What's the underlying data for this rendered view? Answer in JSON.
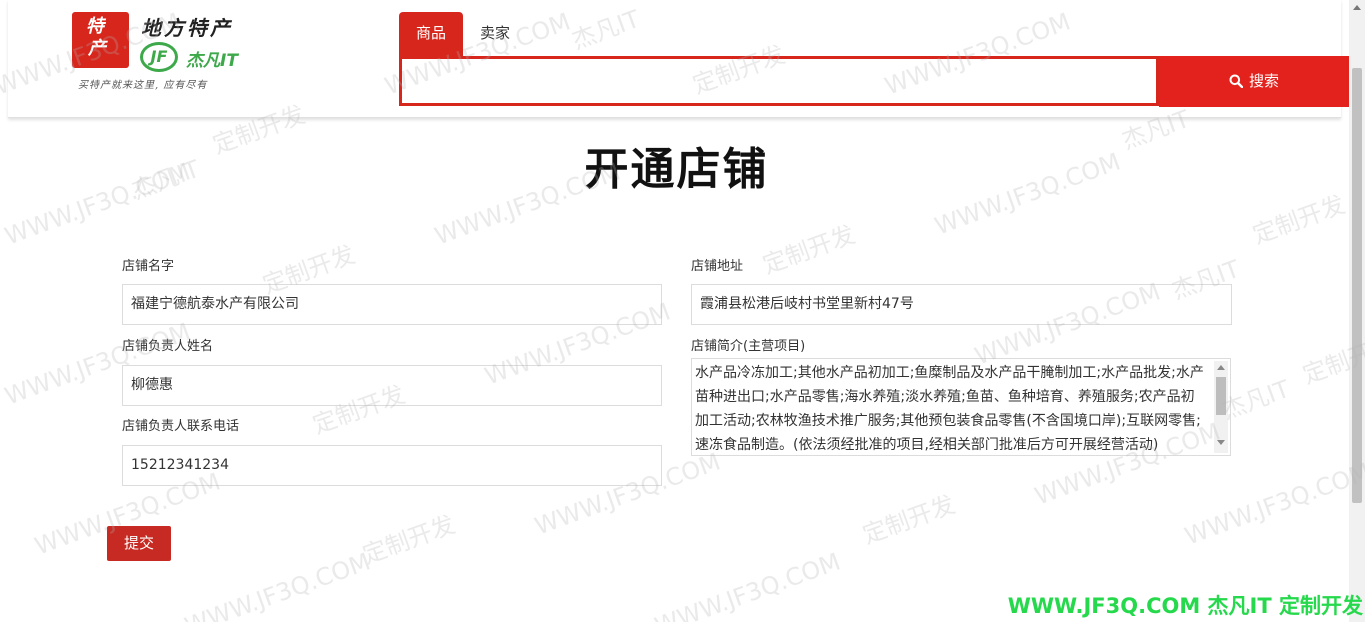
{
  "header": {
    "logo": {
      "badge_top": "特",
      "badge_bottom": "产",
      "title": "地方特产",
      "jf_mark": "JF",
      "jf_name": "杰凡IT",
      "slogan": "买特产就来这里, 应有尽有"
    },
    "tabs": [
      {
        "label": "商品",
        "active": true
      },
      {
        "label": "卖家",
        "active": false
      }
    ],
    "search": {
      "placeholder": "",
      "value": "",
      "button_label": "搜索"
    }
  },
  "main": {
    "title": "开通店铺",
    "fields": {
      "shop_name": {
        "label": "店铺名字",
        "value": "福建宁德航泰水产有限公司"
      },
      "shop_address": {
        "label": "店铺地址",
        "value": "霞浦县松港后岐村书堂里新村47号"
      },
      "owner_name": {
        "label": "店铺负责人姓名",
        "value": "柳德惠"
      },
      "shop_intro": {
        "label": "店铺简介(主营项目)",
        "value": "水产品冷冻加工;其他水产品初加工;鱼糜制品及水产品干腌制加工;水产品批发;水产苗种进出口;水产品零售;海水养殖;淡水养殖;鱼苗、鱼种培育、养殖服务;农产品初加工活动;农林牧渔技术推广服务;其他预包装食品零售(不含国境口岸);互联网零售;速冻食品制造。(依法须经批准的项目,经相关部门批准后方可开展经营活动)"
      },
      "owner_phone": {
        "label": "店铺负责人联系电话",
        "value": "15212341234"
      }
    },
    "submit_label": "提交"
  },
  "watermark": {
    "text_site": "WWW.JF3Q.COM",
    "text_brand": "杰凡IT",
    "text_custom": "定制开发",
    "bottom_banner": "WWW.JF3Q.COM 杰凡IT  定制开发",
    "bottom_color": "#26d94c"
  },
  "colors": {
    "accent": "#d7261c",
    "submit": "#c62a23"
  }
}
